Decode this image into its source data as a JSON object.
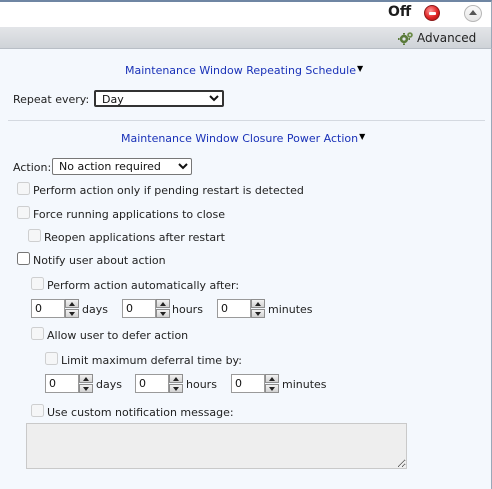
{
  "header": {
    "status_label": "Off",
    "stop_icon": "stop-icon",
    "collapse_icon": "chevron-up-icon"
  },
  "toolbar": {
    "advanced_label": "Advanced",
    "advanced_icon": "gear-icon"
  },
  "repeating_schedule": {
    "title": "Maintenance Window Repeating Schedule",
    "repeat_label": "Repeat every:",
    "repeat_value": "Day"
  },
  "closure_action": {
    "title": "Maintenance Window Closure Power Action",
    "action_label": "Action:",
    "action_value": "No action required",
    "options": {
      "pending_restart": "Perform action only if pending restart is detected",
      "force_close": "Force running applications to close",
      "reopen_apps": "Reopen applications after restart",
      "notify_user": "Notify user about action",
      "auto_after": "Perform action automatically after:",
      "allow_defer": "Allow user to defer action",
      "limit_deferral": "Limit maximum deferral time by:",
      "custom_message": "Use custom notification message:"
    },
    "auto": {
      "days": "0",
      "hours": "0",
      "minutes": "0"
    },
    "deferral": {
      "days": "0",
      "hours": "0",
      "minutes": "0"
    },
    "units": {
      "days": "days",
      "hours": "hours",
      "minutes": "minutes"
    }
  },
  "colors": {
    "section_title": "#1a32b8",
    "panel_background": "#f4f8fd",
    "stop_button": "#e02424"
  }
}
